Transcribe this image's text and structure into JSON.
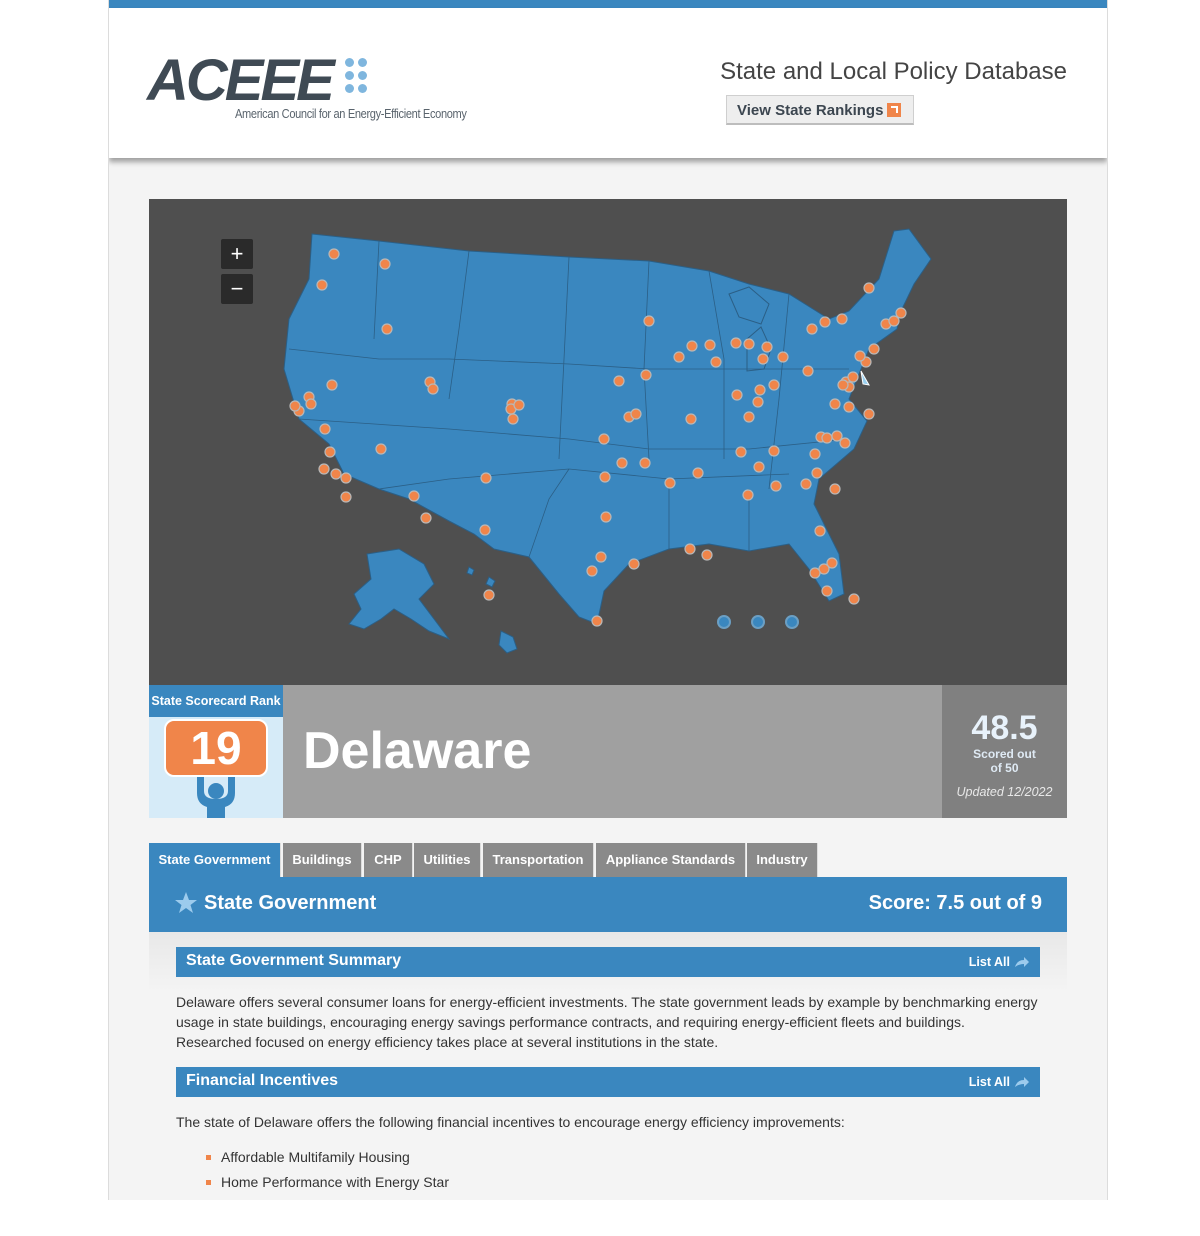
{
  "header": {
    "logo_text": "ACEEE",
    "logo_subtitle": "American Council for an Energy-Efficient Economy",
    "site_title": "State and Local Policy Database",
    "rankings_button": "View State Rankings"
  },
  "map": {
    "zoom_in": "+",
    "zoom_out": "−",
    "pagination_dots": 3,
    "colors": {
      "land": "#3a87bf",
      "background": "#4f4f4f",
      "marker": "#f0854a"
    }
  },
  "state": {
    "rank_label": "State Scorecard Rank",
    "rank": "19",
    "name": "Delaware",
    "score": "48.5",
    "score_caption_1": "Scored out",
    "score_caption_2": "of 50",
    "updated": "Updated 12/2022"
  },
  "tabs": [
    {
      "label": "State Government",
      "active": true
    },
    {
      "label": "Buildings",
      "active": false
    },
    {
      "label": "CHP",
      "active": false
    },
    {
      "label": "Utilities",
      "active": false
    },
    {
      "label": "Transportation",
      "active": false
    },
    {
      "label": "Appliance Standards",
      "active": false
    },
    {
      "label": "Industry",
      "active": false
    }
  ],
  "section": {
    "title": "State Government",
    "score": "Score: 7.5 out of 9",
    "icon": "star-icon"
  },
  "summary": {
    "title": "State Government Summary",
    "list_all": "List All",
    "text": "Delaware offers several consumer loans for energy-efficient investments. The state government leads by example by benchmarking energy usage in state buildings, encouraging energy savings performance contracts, and requiring energy-efficient fleets and buildings. Researched focused on energy efficiency takes place at several institutions in the state."
  },
  "incentives": {
    "title": "Financial Incentives",
    "list_all": "List All",
    "intro": "The state of Delaware offers the following financial incentives to encourage energy efficiency improvements:",
    "items": [
      "Affordable Multifamily Housing",
      "Home Performance with Energy Star"
    ]
  }
}
